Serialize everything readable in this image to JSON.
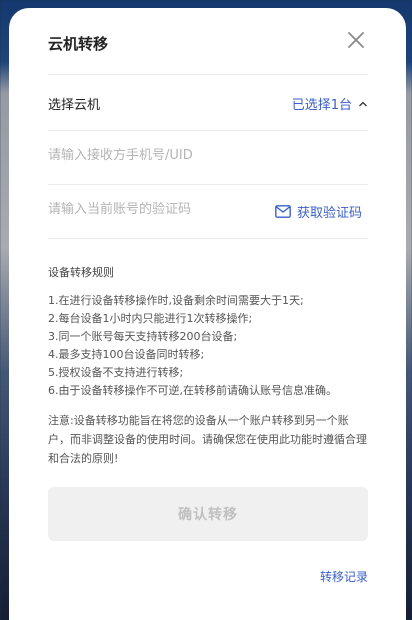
{
  "modal": {
    "title": "云机转移"
  },
  "select_row": {
    "label": "选择云机",
    "value": "已选择1台"
  },
  "phone_input": {
    "placeholder": "请输入接收方手机号/UID",
    "value": ""
  },
  "code_input": {
    "placeholder": "请输入当前账号的验证码",
    "value": ""
  },
  "get_code_label": "获取验证码",
  "rules": {
    "title": "设备转移规则",
    "items": [
      "1.在进行设备转移操作时,设备剩余时间需要大于1天;",
      "2.每台设备1小时内只能进行1次转移操作;",
      "3.同一个账号每天支持转移200台设备;",
      "4.最多支持100台设备同时转移;",
      "5.授权设备不支持进行转移;",
      "6.由于设备转移操作不可逆,在转移前请确认账号信息准确。"
    ]
  },
  "notice": "注意:设备转移功能旨在将您的设备从一个账户转移到另一个账户，而非调整设备的使用时间。请确保您在使用此功能时遵循合理和合法的原则!",
  "confirm_label": "确认转移",
  "history_label": "转移记录",
  "colors": {
    "accent": "#3a5fc8",
    "disabled_bg": "#f0f0f0",
    "disabled_text": "#c0c0c0"
  }
}
